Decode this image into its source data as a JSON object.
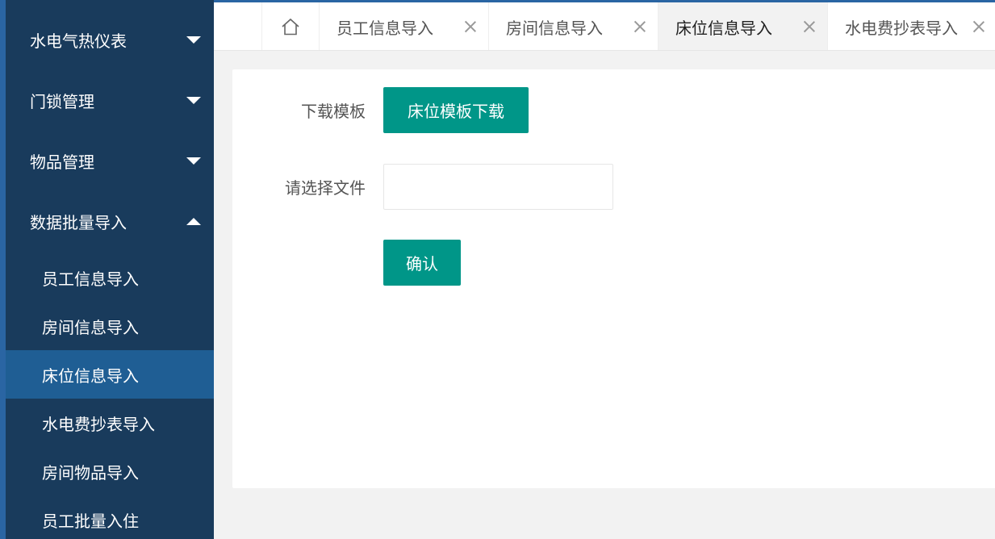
{
  "sidebar": {
    "groups": [
      {
        "label": "水电气热仪表"
      },
      {
        "label": "门锁管理"
      },
      {
        "label": "物品管理"
      },
      {
        "label": "数据批量导入"
      }
    ],
    "subitems": [
      {
        "label": "员工信息导入"
      },
      {
        "label": "房间信息导入"
      },
      {
        "label": "床位信息导入"
      },
      {
        "label": "水电费抄表导入"
      },
      {
        "label": "房间物品导入"
      },
      {
        "label": "员工批量入住"
      }
    ]
  },
  "tabs": [
    {
      "label": "员工信息导入"
    },
    {
      "label": "房间信息导入"
    },
    {
      "label": "床位信息导入"
    },
    {
      "label": "水电费抄表导入"
    }
  ],
  "form": {
    "download_label": "下载模板",
    "download_button": "床位模板下载",
    "file_label": "请选择文件",
    "file_value": "",
    "confirm_button": "确认"
  },
  "colors": {
    "sidebar_bg": "#193b5c",
    "sidebar_active": "#1f5e94",
    "accent": "#009688"
  }
}
